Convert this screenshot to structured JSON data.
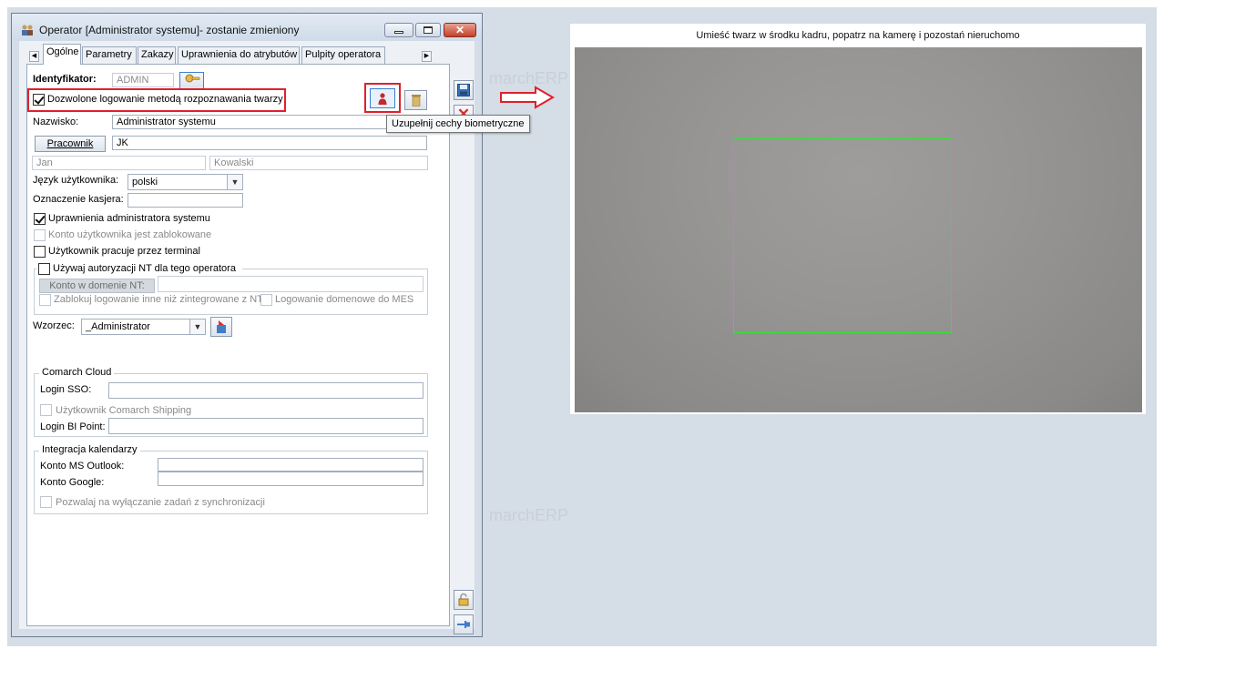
{
  "window": {
    "title": "Operator [Administrator systemu]- zostanie zmieniony"
  },
  "tabs": [
    {
      "label": "Ogólne",
      "active": true
    },
    {
      "label": "Parametry",
      "active": false
    },
    {
      "label": "Zakazy",
      "active": false
    },
    {
      "label": "Uprawnienia do atrybutów",
      "active": false
    },
    {
      "label": "Pulpity operatora",
      "active": false
    }
  ],
  "form": {
    "identyfikator_label": "Identyfikator:",
    "identyfikator_value": "ADMIN",
    "face_login_label": "Dozwolone logowanie metodą rozpoznawania twarzy",
    "face_login_checked": true,
    "nazwisko_label": "Nazwisko:",
    "nazwisko_value": "Administrator systemu",
    "pracownik_button": "Pracownik",
    "pracownik_value": "JK",
    "first_name": "Jan",
    "last_name": "Kowalski",
    "jezyk_label": "Język użytkownika:",
    "jezyk_value": "polski",
    "kasjer_label": "Oznaczenie kasjera:",
    "kasjer_value": "",
    "admin_rights_label": "Uprawnienia administratora systemu",
    "admin_rights_checked": true,
    "account_locked_label": "Konto użytkownika jest zablokowane",
    "terminal_label": "Użytkownik pracuje przez terminal",
    "nt_auth_label": "Używaj autoryzacji NT dla tego operatora",
    "nt_domain_button": "Konto w domenie NT:",
    "nt_domain_value": "",
    "block_non_nt_label": "Zablokuj logowanie inne niż zintegrowane z NT",
    "domain_mes_label": "Logowanie domenowe do MES",
    "wzorzec_label": "Wzorzec:",
    "wzorzec_value": "_Administrator"
  },
  "cloud": {
    "title": "Comarch Cloud",
    "login_sso_label": "Login SSO:",
    "login_sso_value": "",
    "shipping_label": "Użytkownik Comarch Shipping",
    "login_bi_label": "Login BI Point:",
    "login_bi_value": ""
  },
  "calendar": {
    "title": "Integracja kalendarzy",
    "ms_outlook_label": "Konto MS Outlook:",
    "ms_outlook_value": "",
    "google_label": "Konto Google:",
    "google_value": "",
    "disable_sync_label": "Pozwalaj na wyłączanie zadań z synchronizacji"
  },
  "tooltip": {
    "text": "Uzupełnij cechy biometryczne"
  },
  "camera": {
    "instruction": "Umieść twarz w środku kadru, popatrz na kamerę i pozostań nieruchomo"
  },
  "watermark": {
    "text": "marchERP"
  },
  "colors": {
    "highlight_red": "#e0202c",
    "face_box_green": "#2ee52e",
    "window_frame": "#d4dde8",
    "background": "#d5dde7"
  }
}
